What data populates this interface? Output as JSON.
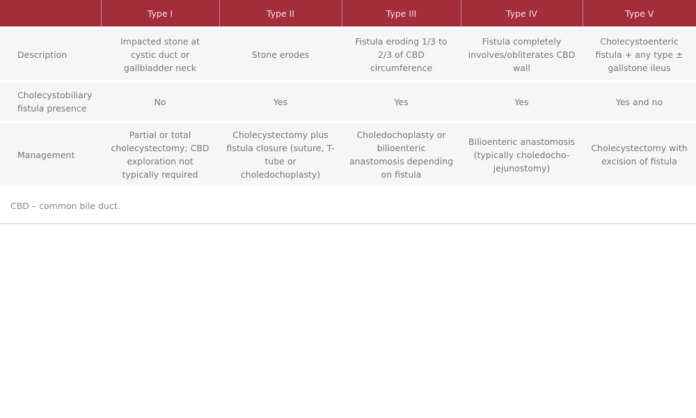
{
  "table": {
    "header": [
      "",
      "Type I",
      "Type II",
      "Type III",
      "Type IV",
      "Type V"
    ],
    "rows": [
      {
        "label": "Description",
        "cells": [
          "Impacted stone at cystic duct or gallbladder neck",
          "Stone erodes",
          "Fistula eroding 1/3 to 2/3 of CBD circumference",
          "Fistula completely involves/obliterates CBD wall",
          "Cholecystoenteric fistula + any type ± gallstone ileus"
        ]
      },
      {
        "label": "Cholecystobiliary fistula presence",
        "cells": [
          "No",
          "Yes",
          "Yes",
          "Yes",
          "Yes and no"
        ]
      },
      {
        "label": "Management",
        "cells": [
          "Partial or total cholecystectomy; CBD exploration not typically required",
          "Cholecystectomy plus fistula closure (suture, T-tube or choledochoplasty)",
          "Choledochoplasty or bilioenteric anastomosis depending on fistula",
          "Bilioenteric anastomosis (typically choledocho-jejunostomy)",
          "Cholecystectomy with excision of fistula"
        ]
      }
    ]
  },
  "footnote": "CBD – common bile duct.",
  "colors": {
    "header_bg": "#a42d3b",
    "row_bg": "#f6f6f6",
    "text": "#777777"
  }
}
